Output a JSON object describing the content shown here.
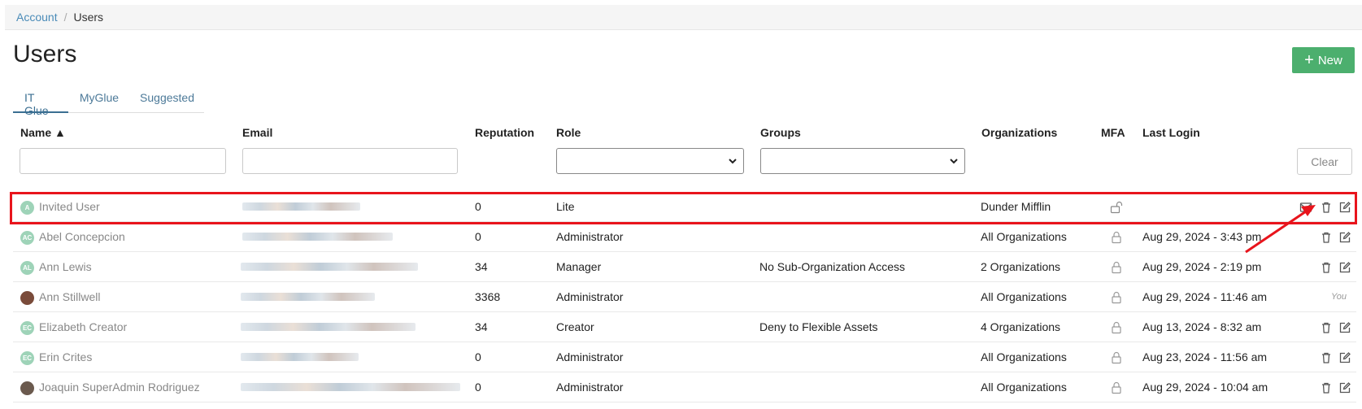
{
  "breadcrumb": {
    "parent": "Account",
    "separator": "/",
    "current": "Users"
  },
  "page": {
    "title": "Users",
    "new_label": "New"
  },
  "tabs": [
    {
      "label": "IT Glue",
      "active": true
    },
    {
      "label": "MyGlue",
      "active": false
    },
    {
      "label": "Suggested",
      "active": false
    }
  ],
  "columns": {
    "name": "Name ▲",
    "email": "Email",
    "reputation": "Reputation",
    "role": "Role",
    "groups": "Groups",
    "organizations": "Organizations",
    "mfa": "MFA",
    "last_login": "Last Login"
  },
  "filters": {
    "clear_label": "Clear"
  },
  "rows": [
    {
      "initials": "A",
      "name": "Invited User",
      "reputation": "0",
      "role": "Lite",
      "groups": "",
      "organizations": "Dunder Mifflin",
      "last_login": ""
    },
    {
      "initials": "AC",
      "name": "Abel Concepcion",
      "reputation": "0",
      "role": "Administrator",
      "groups": "",
      "organizations": "All Organizations",
      "last_login": "Aug 29, 2024 - 3:43 pm"
    },
    {
      "initials": "AL",
      "name": "Ann Lewis",
      "reputation": "34",
      "role": "Manager",
      "groups": "No Sub-Organization Access",
      "organizations": "2 Organizations",
      "last_login": "Aug 29, 2024 - 2:19 pm"
    },
    {
      "initials": "",
      "name": "Ann Stillwell",
      "reputation": "3368",
      "role": "Administrator",
      "groups": "",
      "organizations": "All Organizations",
      "last_login": "Aug 29, 2024 - 11:46 am",
      "you_label": "You"
    },
    {
      "initials": "EC",
      "name": "Elizabeth Creator",
      "reputation": "34",
      "role": "Creator",
      "groups": "Deny to Flexible Assets",
      "organizations": "4 Organizations",
      "last_login": "Aug 13, 2024 - 8:32 am"
    },
    {
      "initials": "EC",
      "name": "Erin Crites",
      "reputation": "0",
      "role": "Administrator",
      "groups": "",
      "organizations": "All Organizations",
      "last_login": "Aug 23, 2024 - 11:56 am"
    },
    {
      "initials": "",
      "name": "Joaquin SuperAdmin Rodriguez",
      "reputation": "0",
      "role": "Administrator",
      "groups": "",
      "organizations": "All Organizations",
      "last_login": "Aug 29, 2024 - 10:04 am"
    }
  ],
  "icons": {
    "mfa_unlocked": "lock-open-icon",
    "mfa_locked": "lock-icon",
    "resend": "envelope-icon",
    "delete": "trash-icon",
    "edit": "edit-icon"
  },
  "colors": {
    "accent": "#3b6f92",
    "new_button": "#4caf6e",
    "highlight": "#e8141c",
    "avatar": "#9ed3b8"
  }
}
